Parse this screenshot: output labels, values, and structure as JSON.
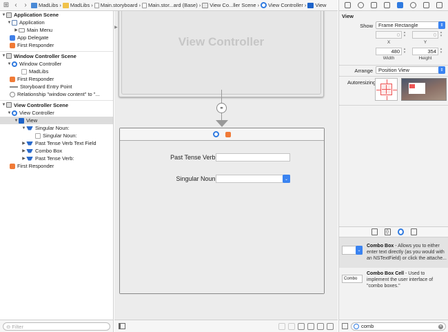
{
  "jumpbar": {
    "crumbs": [
      "MadLibs",
      "MadLibs",
      "Main.storyboard",
      "Main.stor...ard (Base)",
      "View Co...ller Scene",
      "View Controller",
      "View"
    ]
  },
  "navigator": {
    "app_scene": {
      "title": "Application Scene",
      "application": "Application",
      "main_menu": "Main Menu",
      "app_delegate": "App Delegate",
      "first_responder": "First Responder"
    },
    "window_scene": {
      "title": "Window Controller Scene",
      "window_controller": "Window Controller",
      "madlibs": "MadLibs",
      "first_responder": "First Responder",
      "entry_point": "Storyboard Entry Point",
      "relationship": "Relationship \"window content\" to \"..."
    },
    "vc_scene": {
      "title": "View Controller Scene",
      "view_controller": "View Controller",
      "view": "View",
      "singular_noun_label": "Singular Noun:",
      "singular_noun_cell": "Singular Noun:",
      "past_tense_field": "Past Tense Verb Text Field",
      "combo_box": "Combo Box",
      "past_tense_label": "Past Tense Verb:",
      "first_responder": "First Responder"
    },
    "filter_placeholder": "Filter"
  },
  "canvas": {
    "top_scene_title": "View Controller",
    "past_tense_label": "Past Tense Verb:",
    "singular_noun_label": "Singular Noun:"
  },
  "inspector": {
    "title": "View",
    "show_label": "Show",
    "show_value": "Frame Rectangle",
    "x_value": "0",
    "y_value": "0",
    "x_label": "X",
    "y_label": "Y",
    "width_value": "480",
    "height_value": "354",
    "width_label": "Width",
    "height_label": "Height",
    "arrange_label": "Arrange",
    "arrange_value": "Position View",
    "autoresizing_label": "Autoresizing"
  },
  "library": {
    "combo_box": {
      "name": "Combo Box",
      "desc": " - Allows you to either enter text directly (as you would with an NSTextField) or click the attache..."
    },
    "combo_box_cell": {
      "name": "Combo Box Cell",
      "desc": " - Used to implement the user interface of \"combo boxes.\"",
      "thumb": "Combo"
    },
    "search_value": "comb"
  }
}
